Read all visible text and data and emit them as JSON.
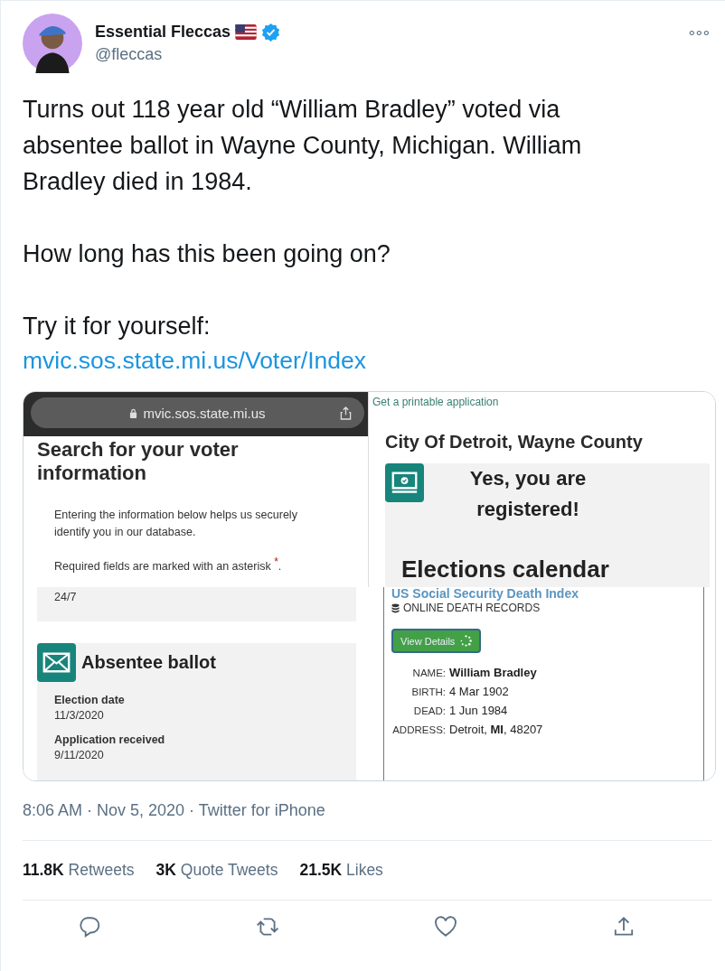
{
  "author": {
    "name": "Essential Fleccas",
    "handle": "@fleccas",
    "verified": true
  },
  "more_button": "∘∘∘",
  "body": [
    "Turns out 118 year old “William Bradley” voted via absentee ballot in Wayne County, Michigan. William Bradley died in 1984.",
    "How long has this been going on?",
    "Try it for yourself:"
  ],
  "link": "mvic.sos.state.mi.us/Voter/Index",
  "collage": {
    "voter_search": {
      "url": "mvic.sos.state.mi.us",
      "heading": "Search for your voter information",
      "intro": "Entering the information below helps us securely identify you in our database.",
      "note": "Required fields are marked with an asterisk $^{*}$."
    },
    "absentee": {
      "hours": "24/7",
      "title": "Absentee ballot",
      "fields": [
        {
          "label": "Election date",
          "value": "11/3/2020"
        },
        {
          "label": "Application received",
          "value": "9/11/2020"
        }
      ]
    },
    "registration": {
      "link": "Get a printable application",
      "location": "City Of Detroit, Wayne County",
      "status": "Yes, you are registered!",
      "next_heading": "Elections calendar"
    },
    "death_index": {
      "title": "US Social Security Death Index",
      "subtitle": "ONLINE DEATH RECORDS",
      "button": "View Details",
      "records": [
        {
          "label": "NAME:",
          "value": "**William Bradley**"
        },
        {
          "label": "BIRTH:",
          "value": "4 Mar 1902"
        },
        {
          "label": "DEAD:",
          "value": "1 Jun 1984"
        },
        {
          "label": "ADDRESS:",
          "value": "Detroit, **MI**, 48207"
        }
      ]
    }
  },
  "meta": "8:06 AM · Nov 5, 2020 · Twitter for iPhone",
  "stats": [
    {
      "count": "11.8K",
      "label": "Retweets"
    },
    {
      "count": "3K",
      "label": "Quote Tweets"
    },
    {
      "count": "21.5K",
      "label": "Likes"
    }
  ],
  "actions": [
    {
      "kind": "reply"
    },
    {
      "kind": "retweet"
    },
    {
      "kind": "like"
    },
    {
      "kind": "share"
    }
  ]
}
